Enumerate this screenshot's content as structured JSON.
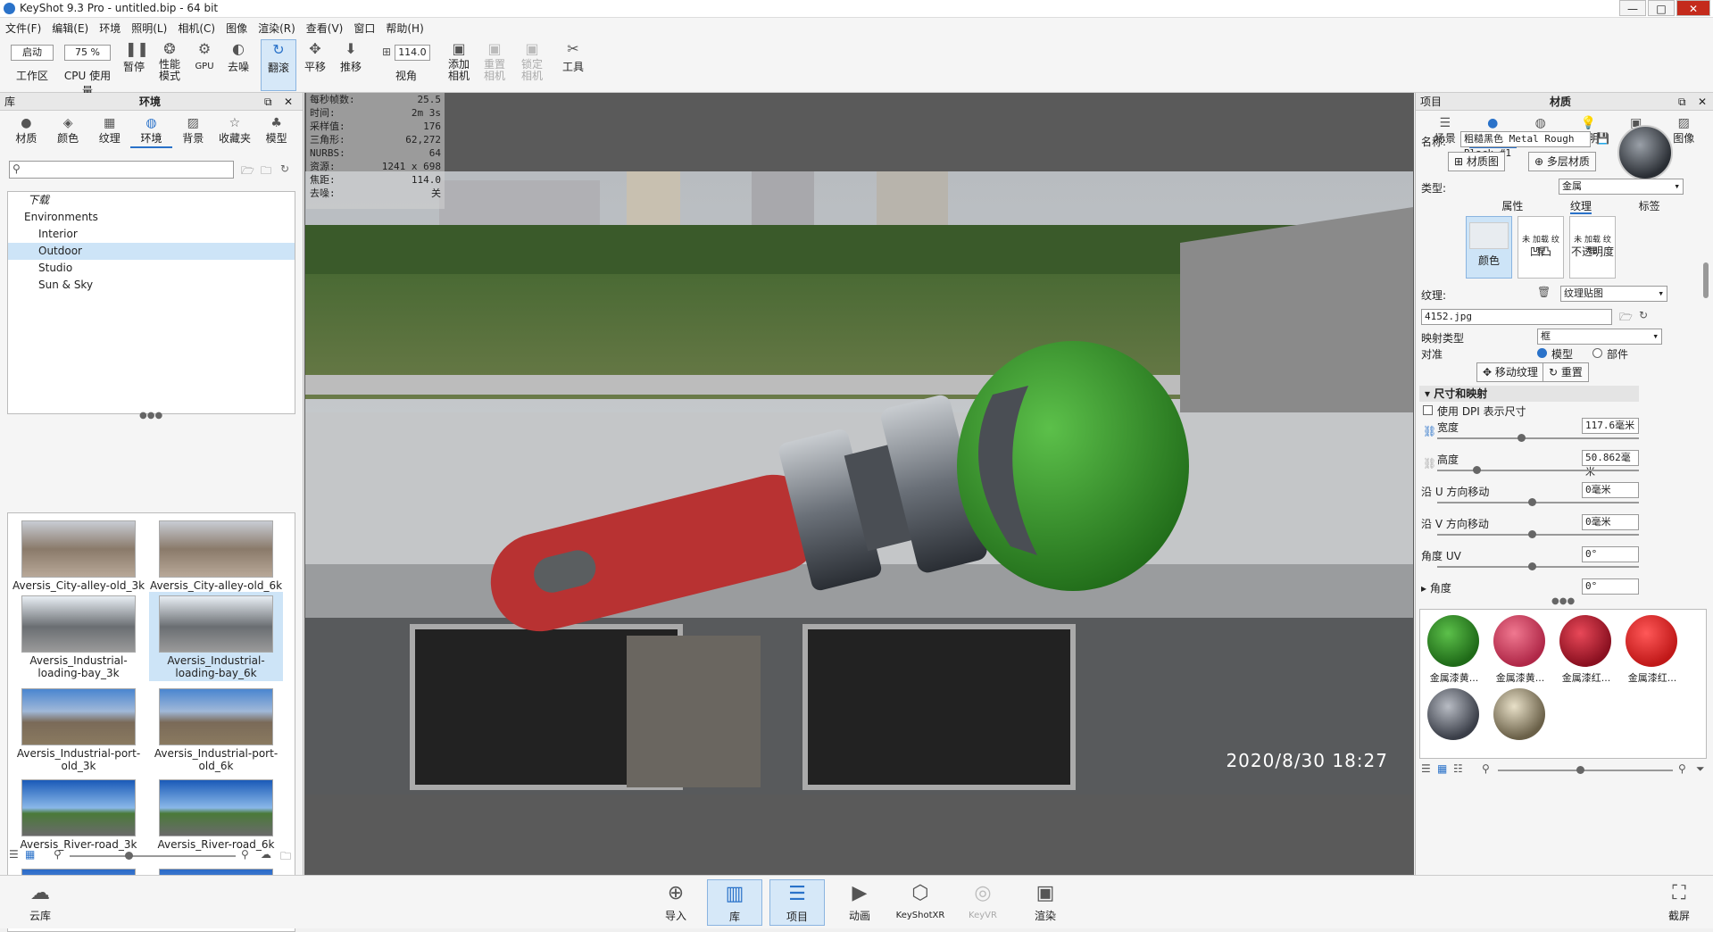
{
  "window": {
    "title": "KeyShot 9.3 Pro  - untitled.bip  - 64 bit",
    "min": "—",
    "max": "□",
    "close": "✕"
  },
  "menu": [
    "文件(F)",
    "编辑(E)",
    "环境",
    "照明(L)",
    "相机(C)",
    "图像",
    "渲染(R)",
    "查看(V)",
    "窗口",
    "帮助(H)"
  ],
  "toolbar": {
    "workspace_select": "启动",
    "workspace_label": "工作区",
    "cpu_select": "75 %",
    "cpu_label": "CPU 使用量",
    "pause": "暂停",
    "perf1": "性能",
    "perf2": "模式",
    "gpu": "GPU",
    "denoise": "去噪",
    "tumble": "翻滚",
    "pan": "平移",
    "dolly": "推移",
    "fov_value": "114.0",
    "fov": "视角",
    "addcam1": "添加",
    "addcam2": "相机",
    "resetcam1": "重置",
    "resetcam2": "相机",
    "lockcam1": "锁定",
    "lockcam2": "相机",
    "tools": "工具"
  },
  "library": {
    "header_left": "库",
    "header_title": "环境",
    "tabs": [
      "材质",
      "颜色",
      "纹理",
      "环境",
      "背景",
      "收藏夹",
      "模型"
    ],
    "active_tab": "环境",
    "tree": [
      "下载",
      "Environments",
      "Interior",
      "Outdoor",
      "Studio",
      "Sun & Sky"
    ],
    "thumbs": [
      "Aversis_City-alley-old_3k",
      "Aversis_City-alley-old_6k",
      "Aversis_Industrial-loading-bay_3k",
      "Aversis_Industrial-loading-bay_6k",
      "Aversis_Industrial-port-old_3k",
      "Aversis_Industrial-port-old_6k",
      "Aversis_River-road_3k",
      "Aversis_River-road_6k"
    ]
  },
  "hud": [
    [
      "每秒帧数:",
      "25.5"
    ],
    [
      "时间:",
      "2m 3s"
    ],
    [
      "采样值:",
      "176"
    ],
    [
      "三角形:",
      "62,272"
    ],
    [
      "NURBS:",
      "64"
    ],
    [
      "资源:",
      "1241 x 698"
    ],
    [
      "焦距:",
      "114.0"
    ],
    [
      "去噪:",
      "关"
    ]
  ],
  "timestamp": "2020/8/30   18:27",
  "project": {
    "header_left": "项目",
    "header_title": "材质",
    "tabs": [
      "场景",
      "材质",
      "环境",
      "照明",
      "相机",
      "图像"
    ],
    "active_tab": "材质",
    "name_label": "名称:",
    "name_value": "粗糙黑色 Metal Rough Black #1",
    "material_graph": "材质图",
    "multi_material": "多层材质",
    "type_label": "类型:",
    "type_value": "金属",
    "subtabs": [
      "属性",
      "纹理",
      "标签"
    ],
    "active_subtab": "纹理",
    "slots": [
      "颜色",
      "凹凸",
      "不透明度"
    ],
    "slot_empty": "未 加载 纹理",
    "texture_label": "纹理:",
    "texture_type": "纹理贴图",
    "texture_file": "4152.jpg",
    "mapping_label": "映射类型",
    "mapping_value": "框",
    "align_label": "对准",
    "align_model": "模型",
    "align_part": "部件",
    "move_texture": "移动纹理",
    "reset": "重置",
    "section": "尺寸和映射",
    "use_dpi": "使用 DPI 表示尺寸",
    "width_label": "宽度",
    "width_value": "117.6毫米",
    "height_label": "高度",
    "height_value": "50.862毫米",
    "umove_label": "沿 U 方向移动",
    "umove_value": "0毫米",
    "vmove_label": "沿 V 方向移动",
    "vmove_value": "0毫米",
    "uv_angle_label": "角度 UV",
    "uv_angle_value": "0°",
    "angle_label": "角度",
    "angle_value": "0°",
    "balls": [
      "金属漆黄...",
      "金属漆黄...",
      "金属漆红...",
      "金属漆红..."
    ]
  },
  "bottom": {
    "cloud": "云库",
    "import": "导入",
    "library": "库",
    "project": "项目",
    "animation": "动画",
    "keyshotxr": "KeyShotXR",
    "keyvr": "KeyVR",
    "render": "渲染",
    "screenshot": "截屏"
  },
  "colors": {
    "accent": "#2a72c9",
    "green": "#3a9a2a",
    "red": "#b83232"
  }
}
